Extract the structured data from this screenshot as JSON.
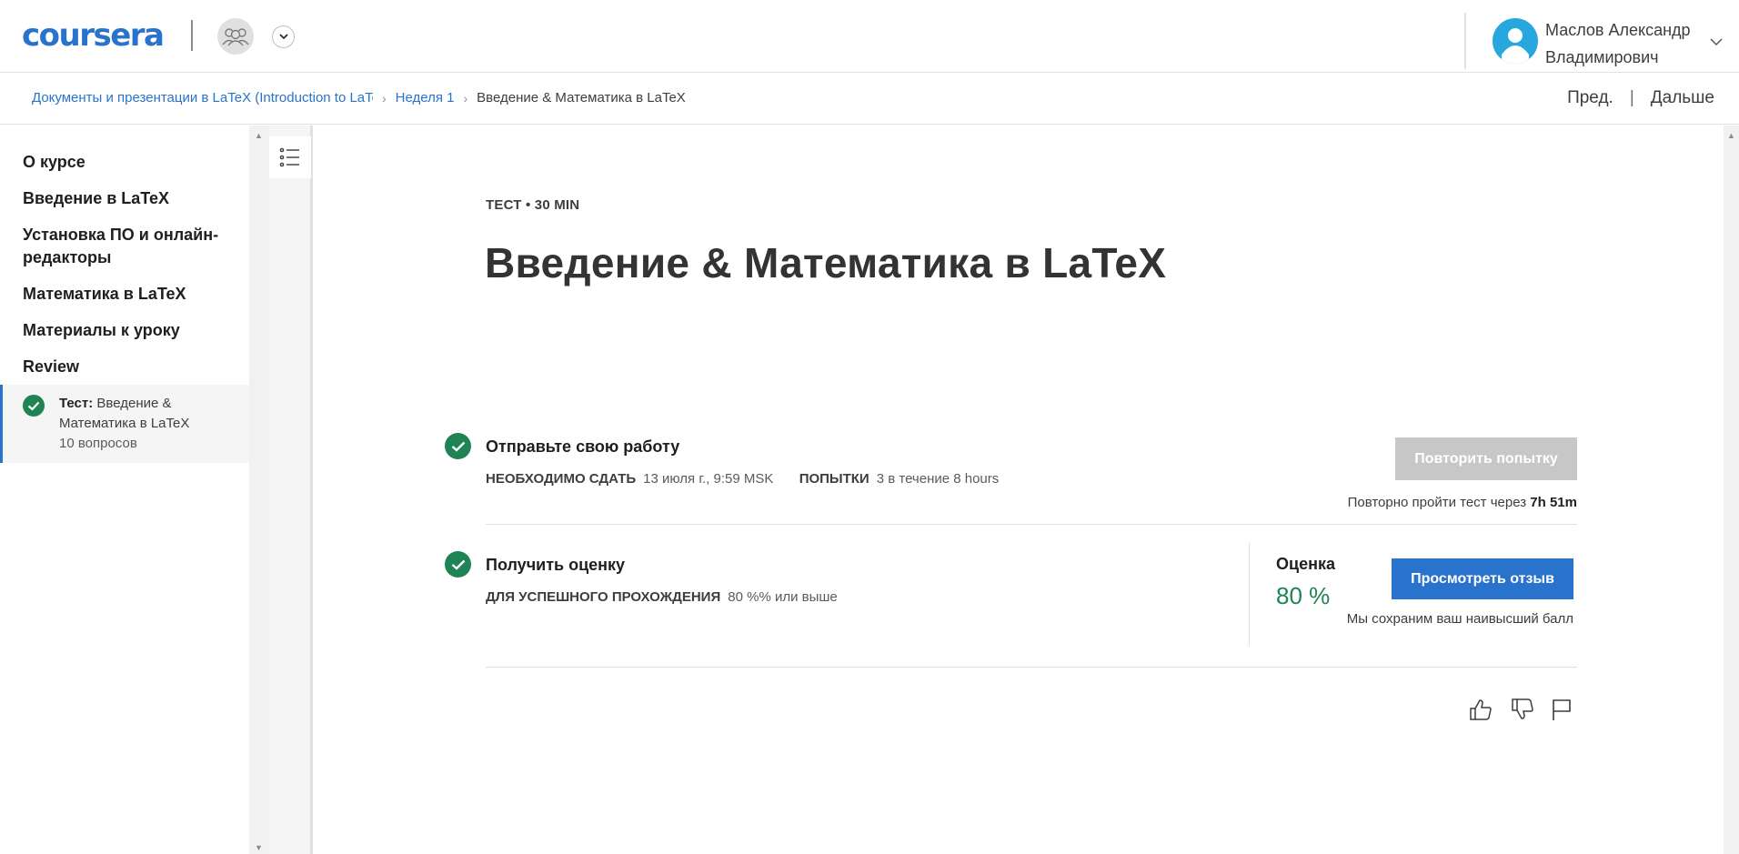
{
  "header": {
    "logo_text": "coursera",
    "user_name": "Маслов Александр Владимирович"
  },
  "breadcrumb": {
    "course": "Документы и презентации в LaTeX (Introduction to LaTeX)",
    "week": "Неделя 1",
    "current": "Введение & Математика в LaTeX",
    "prev": "Пред.",
    "separator": "|",
    "next": "Дальше"
  },
  "sidebar": {
    "items": [
      {
        "label": "О курсе"
      },
      {
        "label": "Введение в LaTeX"
      },
      {
        "label": "Установка ПО и онлайн-редакторы"
      },
      {
        "label": "Математика в LaTeX"
      },
      {
        "label": "Материалы к уроку"
      },
      {
        "label": "Review"
      }
    ],
    "active": {
      "prefix": "Тест:",
      "title": "Введение & Математика в LaTeX",
      "count": "10 вопросов"
    }
  },
  "main": {
    "eyebrow": "ТЕСТ • 30 MIN",
    "title": "Введение & Математика в LaTeX",
    "submit": {
      "title": "Отправьте свою работу",
      "due_label": "НЕОБХОДИМО СДАТЬ",
      "due_value": "13 июля г., 9:59 MSK",
      "attempts_label": "ПОПЫТКИ",
      "attempts_value": "3 в течение 8 hours",
      "retry_button": "Повторить попытку",
      "retry_note_text": "Повторно пройти тест через",
      "retry_note_time": "7h 51m"
    },
    "grade": {
      "title": "Получить оценку",
      "pass_label": "ДЛЯ УСПЕШНОГО ПРОХОЖДЕНИЯ",
      "pass_value": "80 %% или выше",
      "grade_label": "Оценка",
      "grade_value": "80 %",
      "review_button": "Просмотреть отзыв",
      "note": "Мы сохраним ваш наивысший балл"
    }
  },
  "colors": {
    "accent": "#2a73cc",
    "success": "#1f8354",
    "disabled": "#c7c7c7"
  },
  "icons": [
    "group-icon",
    "chevron-down-icon",
    "user-avatar-icon",
    "check-icon",
    "list-icon",
    "thumbs-up-icon",
    "thumbs-down-icon",
    "flag-icon"
  ]
}
